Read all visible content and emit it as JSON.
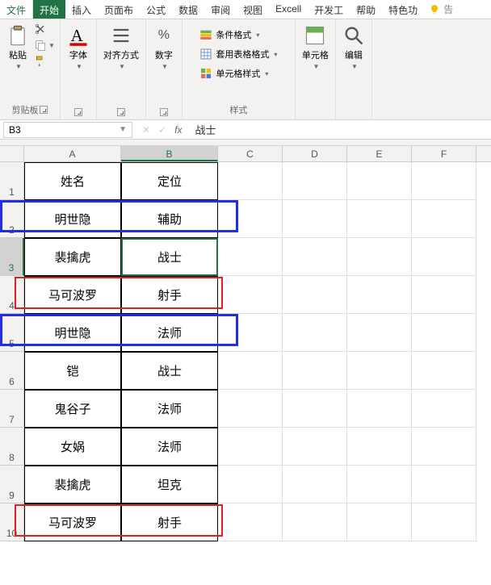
{
  "tabs": {
    "file": "文件",
    "home": "开始",
    "insert": "插入",
    "page_layout": "页面布",
    "formulas": "公式",
    "data": "数据",
    "review": "审阅",
    "view": "视图",
    "excel": "Excell",
    "developer": "开发工",
    "help": "帮助",
    "special": "特色功",
    "tell_me": "告"
  },
  "ribbon": {
    "clipboard": {
      "label": "剪贴板",
      "paste": "粘贴"
    },
    "font": {
      "label": "字体"
    },
    "alignment": {
      "label": "对齐方式"
    },
    "number": {
      "label": "数字"
    },
    "styles": {
      "label": "样式",
      "conditional": "条件格式",
      "format_table": "套用表格格式",
      "cell_styles": "单元格样式"
    },
    "cells": {
      "label": "单元格"
    },
    "editing": {
      "label": "编辑"
    }
  },
  "namebox": "B3",
  "formula_value": "战士",
  "columns": [
    "A",
    "B",
    "C",
    "D",
    "E",
    "F"
  ],
  "row_numbers": [
    "1",
    "2",
    "3",
    "4",
    "5",
    "6",
    "7",
    "8",
    "9",
    "10"
  ],
  "table": {
    "r1": {
      "a": "姓名",
      "b": "定位"
    },
    "r2": {
      "a": "明世隐",
      "b": "辅助"
    },
    "r3": {
      "a": "裴擒虎",
      "b": "战士"
    },
    "r4": {
      "a": "马可波罗",
      "b": "射手"
    },
    "r5": {
      "a": "明世隐",
      "b": "法师"
    },
    "r6": {
      "a": "铠",
      "b": "战士"
    },
    "r7": {
      "a": "鬼谷子",
      "b": "法师"
    },
    "r8": {
      "a": "女娲",
      "b": "法师"
    },
    "r9": {
      "a": "裴擒虎",
      "b": "坦克"
    },
    "r10": {
      "a": "马可波罗",
      "b": "射手"
    }
  },
  "active_cell": "B3",
  "highlights": [
    {
      "type": "blue",
      "rows": [
        2
      ]
    },
    {
      "type": "blue",
      "rows": [
        5
      ]
    },
    {
      "type": "red",
      "rows": [
        4
      ]
    },
    {
      "type": "red",
      "rows": [
        10
      ]
    }
  ],
  "chart_data": {
    "type": "table",
    "headers": [
      "姓名",
      "定位"
    ],
    "rows": [
      [
        "明世隐",
        "辅助"
      ],
      [
        "裴擒虎",
        "战士"
      ],
      [
        "马可波罗",
        "射手"
      ],
      [
        "明世隐",
        "法师"
      ],
      [
        "铠",
        "战士"
      ],
      [
        "鬼谷子",
        "法师"
      ],
      [
        "女娲",
        "法师"
      ],
      [
        "裴擒虎",
        "坦克"
      ],
      [
        "马可波罗",
        "射手"
      ]
    ]
  }
}
